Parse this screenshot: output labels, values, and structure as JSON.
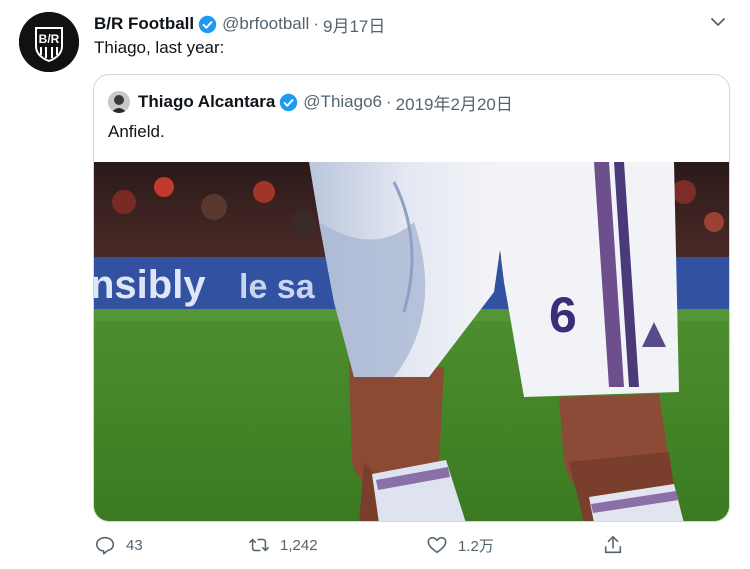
{
  "tweet": {
    "author_name": "B/R Football",
    "handle": "@brfootball",
    "date": "9月17日",
    "text": "Thiago, last year:",
    "avatar_logo": "B/R"
  },
  "quote": {
    "author_name": "Thiago Alcantara",
    "handle": "@Thiago6",
    "date": "2019年2月20日",
    "text": "Anfield.",
    "media": {
      "banner_text": "nsibly",
      "banner_text_2": "le sa",
      "shirt_number": "6"
    }
  },
  "actions": {
    "replies": "43",
    "retweets": "1,242",
    "likes": "1.2万"
  },
  "colors": {
    "verified": "#1d9bf0",
    "muted": "#536471",
    "border": "#cfd9de"
  }
}
